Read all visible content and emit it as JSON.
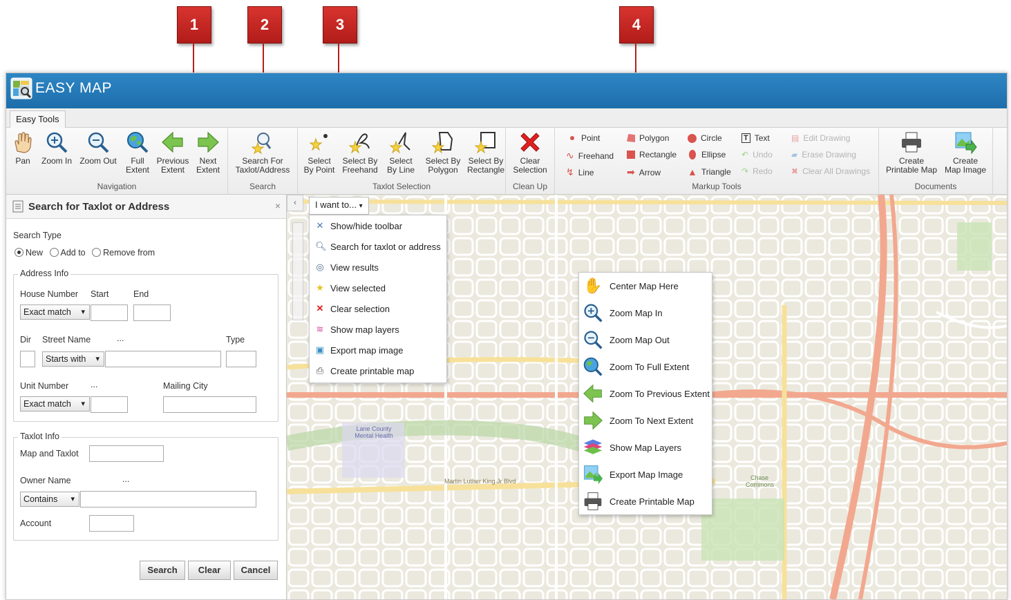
{
  "callouts": [
    "1",
    "2",
    "3",
    "4"
  ],
  "app": {
    "title": "EASY MAP"
  },
  "tabs": [
    {
      "label": "Easy Tools"
    }
  ],
  "ribbon": {
    "navigation": {
      "group_label": "Navigation",
      "buttons": [
        {
          "label": "Pan",
          "icon": "hand-icon"
        },
        {
          "label": "Zoom In",
          "icon": "zoom-in-icon"
        },
        {
          "label": "Zoom Out",
          "icon": "zoom-out-icon"
        },
        {
          "label1": "Full",
          "label2": "Extent",
          "icon": "globe-zoom-icon"
        },
        {
          "label1": "Previous",
          "label2": "Extent",
          "icon": "arrow-left-icon"
        },
        {
          "label1": "Next",
          "label2": "Extent",
          "icon": "arrow-right-icon"
        }
      ]
    },
    "search": {
      "group_label": "Search",
      "label1": "Search For",
      "label2": "Taxlot/Address",
      "icon": "search-star-icon"
    },
    "taxlot": {
      "group_label": "Taxlot Selection",
      "buttons": [
        {
          "label1": "Select",
          "label2": "By Point"
        },
        {
          "label1": "Select By",
          "label2": "Freehand"
        },
        {
          "label1": "Select",
          "label2": "By Line"
        },
        {
          "label1": "Select By",
          "label2": "Polygon"
        },
        {
          "label1": "Select By",
          "label2": "Rectangle"
        }
      ]
    },
    "cleanup": {
      "group_label": "Clean Up",
      "label1": "Clear",
      "label2": "Selection"
    },
    "markup": {
      "group_label": "Markup Tools",
      "col1": [
        "Point",
        "Freehand",
        "Line"
      ],
      "col2": [
        "Polygon",
        "Rectangle",
        "Arrow"
      ],
      "col3": [
        "Circle",
        "Ellipse",
        "Triangle"
      ],
      "col4": [
        "Text",
        "Undo",
        "Redo"
      ],
      "col5": [
        "Edit Drawing",
        "Erase Drawing",
        "Clear All Drawings"
      ]
    },
    "documents": {
      "group_label": "Documents",
      "buttons": [
        {
          "label1": "Create",
          "label2": "Printable Map"
        },
        {
          "label1": "Create",
          "label2": "Map Image"
        }
      ]
    }
  },
  "panel": {
    "title": "Search for Taxlot or Address",
    "close": "×",
    "search_type_label": "Search Type",
    "search_type_options": [
      "New",
      "Add to",
      "Remove from"
    ],
    "address_legend": "Address Info",
    "house_number_label": "House Number",
    "start_label": "Start",
    "end_label": "End",
    "house_match": "Exact match",
    "dir_label": "Dir",
    "street_name_label": "Street Name",
    "ellipsis": "...",
    "type_label": "Type",
    "street_match": "Starts with",
    "unit_number_label": "Unit Number",
    "mailing_city_label": "Mailing City",
    "unit_match": "Exact match",
    "taxlot_legend": "Taxlot Info",
    "map_taxlot_label": "Map and Taxlot",
    "owner_name_label": "Owner Name",
    "owner_match": "Contains",
    "account_label": "Account",
    "buttons": [
      "Search",
      "Clear",
      "Cancel"
    ]
  },
  "map": {
    "toggle": "‹",
    "iwant_label": "I want to...",
    "iwant_items": [
      "Show/hide toolbar",
      "Search for taxlot or address",
      "View results",
      "View selected",
      "Clear selection",
      "Show map layers",
      "Export map image",
      "Create printable map"
    ],
    "context_items": [
      "Center Map Here",
      "Zoom Map In",
      "Zoom Map Out",
      "Zoom To Full Extent",
      "Zoom To Previous Extent",
      "Zoom To Next Extent",
      "Show Map Layers",
      "Export Map Image",
      "Create Printable Map"
    ],
    "labels": [
      "Lane County Mental Health",
      "Martin Luther King Jr Blvd",
      "Chase Commons"
    ]
  }
}
